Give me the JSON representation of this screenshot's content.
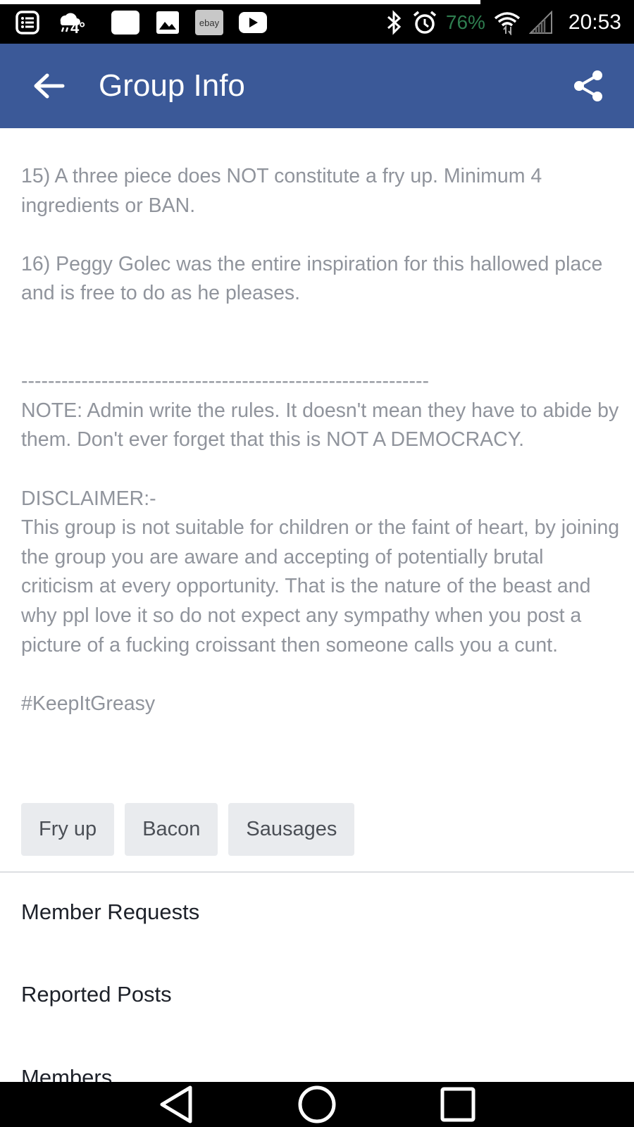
{
  "status_bar": {
    "temperature": "4°",
    "ebay_label": "ebay",
    "battery": "76%",
    "time": "20:53",
    "battery_color": "#2e7d4f"
  },
  "app_bar": {
    "title": "Group Info",
    "color": "#3b5998",
    "back_icon": "arrow-left-icon",
    "share_icon": "share-icon"
  },
  "description": {
    "text": "15) A three piece does NOT constitute a fry up. Minimum 4 ingredients or BAN.\n\n16) Peggy Golec was the entire inspiration for this hallowed place and is free to do as he pleases.\n\n\n-------------------------------------------------------------\nNOTE: Admin write the rules. It doesn't mean they have to abide by them. Don't ever forget that this is NOT A DEMOCRACY.\n\nDISCLAIMER:-\nThis group is not suitable for children or the faint of heart, by joining the group you are aware and accepting of potentially brutal criticism at every opportunity. That is the nature of the beast and why ppl love it so do not expect any sympathy when you post a picture of a fucking croissant then someone calls you a cunt.\n\n#KeepItGreasy"
  },
  "tags": [
    "Fry up",
    "Bacon",
    "Sausages"
  ],
  "menu": {
    "member_requests": "Member Requests",
    "reported_posts": "Reported Posts",
    "members": "Members"
  },
  "nav_bar": {
    "back_icon": "triangle-back-icon",
    "home_icon": "circle-home-icon",
    "recents_icon": "square-recents-icon"
  }
}
